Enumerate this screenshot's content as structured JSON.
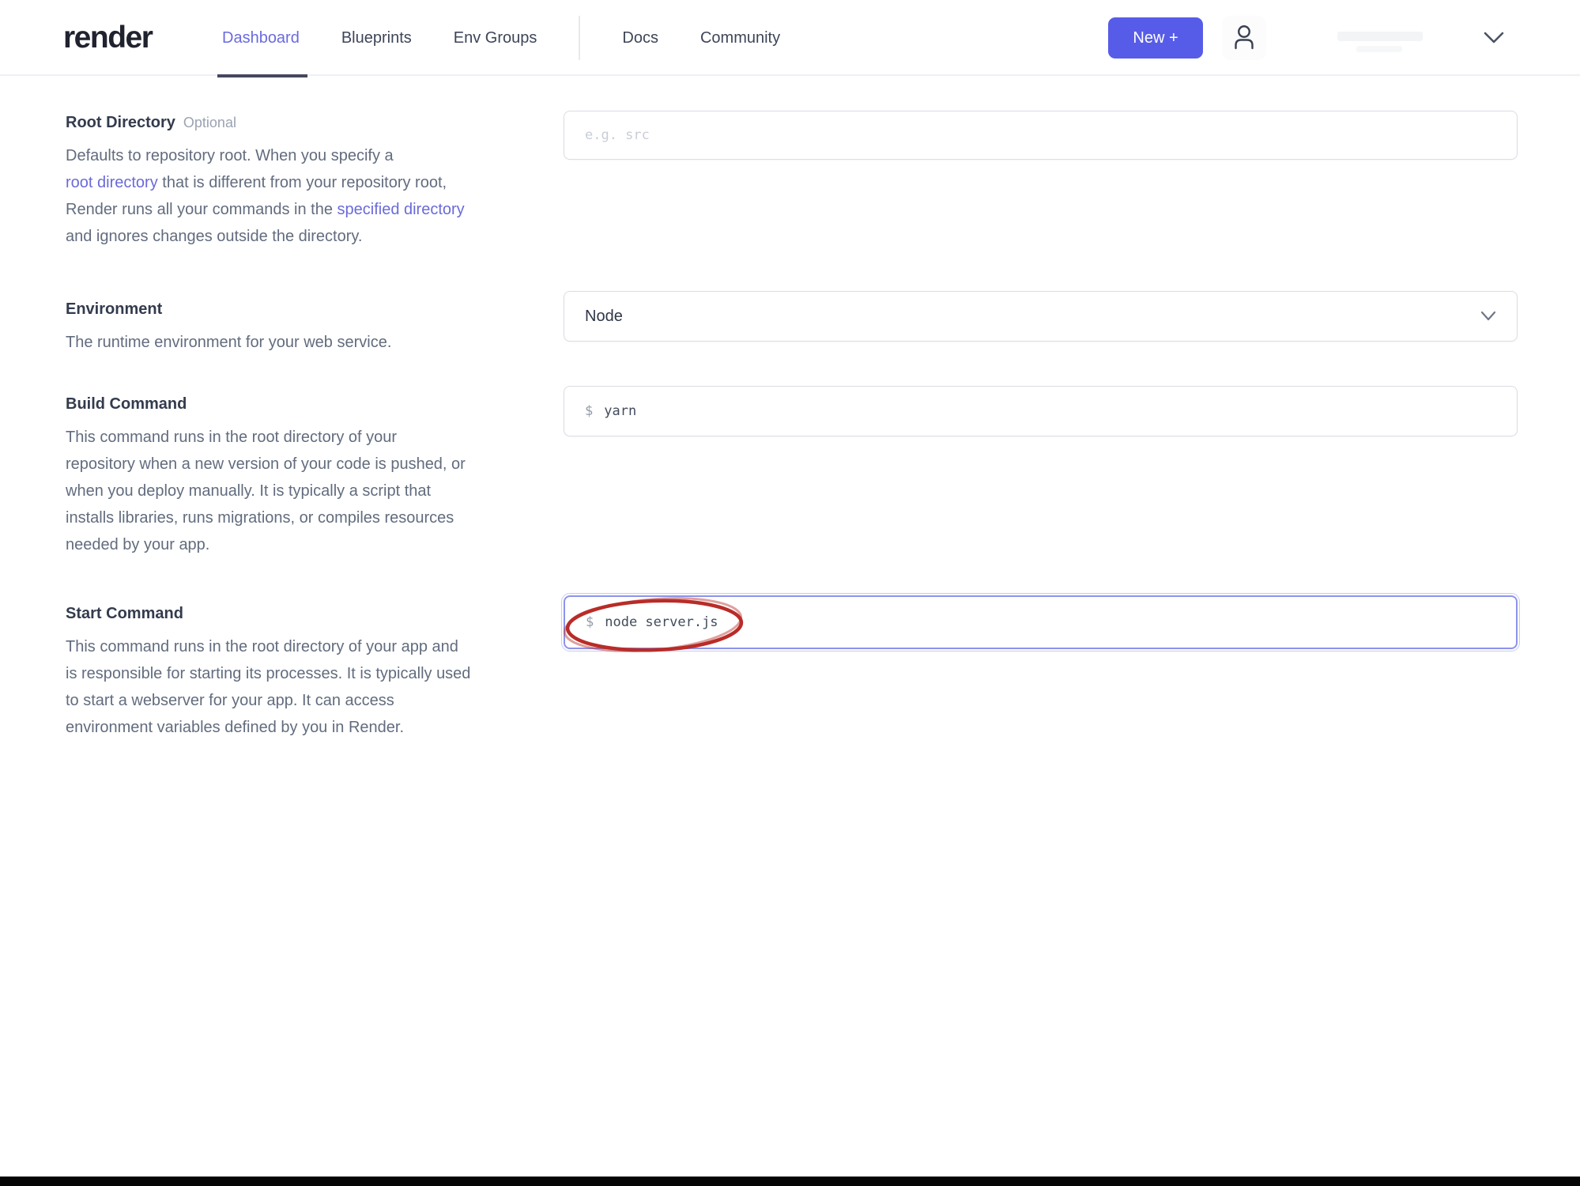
{
  "header": {
    "logo": "render",
    "nav": [
      {
        "label": "Dashboard",
        "active": true
      },
      {
        "label": "Blueprints",
        "active": false
      },
      {
        "label": "Env Groups",
        "active": false
      },
      {
        "label": "Docs",
        "active": false
      },
      {
        "label": "Community",
        "active": false
      }
    ],
    "new_button_label": "New +",
    "icons": {
      "user": "user-icon",
      "account_chevron": "chevron-down-icon"
    }
  },
  "form": {
    "root_directory": {
      "label": "Root Directory",
      "tag": "Optional",
      "desc": {
        "line1": "Defaults to repository root. When you specify a",
        "line2_link": "root directory",
        "line2_rest": " that is different from your repository root,",
        "line3_pre": "Render runs all your commands in the ",
        "line3_link": "specified directory",
        "line4": "and ignores changes outside the directory."
      },
      "input": {
        "placeholder": "e.g. src",
        "value": ""
      }
    },
    "environment": {
      "label": "Environment",
      "desc": "The runtime environment for your web service.",
      "select": {
        "value": "Node",
        "icon": "chevron-down-icon"
      }
    },
    "build_command": {
      "label": "Build Command",
      "desc_lines": [
        "This command runs in the root directory of your",
        "repository when a new version of your code is pushed, or",
        "when you deploy manually. It is typically a script that",
        "installs libraries, runs migrations, or compiles resources",
        "needed by your app."
      ],
      "input": {
        "prefix": "$",
        "value": "yarn"
      }
    },
    "start_command": {
      "label": "Start Command",
      "desc_lines": [
        "This command runs in the root directory of your app and",
        "is responsible for starting its processes. It is typically used",
        "to start a webserver for your app. It can access",
        "environment variables defined by you in Render."
      ],
      "input": {
        "prefix": "$",
        "value": "node server.js"
      },
      "annotation": "red-ellipse"
    }
  },
  "colors": {
    "accent": "#575ce8",
    "active_tab": "#6a6ae0",
    "tab_underline": "#45475e",
    "link": "#6a6ada",
    "focus_border": "#8d94ec",
    "annotation_red": "#b92c28",
    "bottom_bar": "#050505"
  }
}
